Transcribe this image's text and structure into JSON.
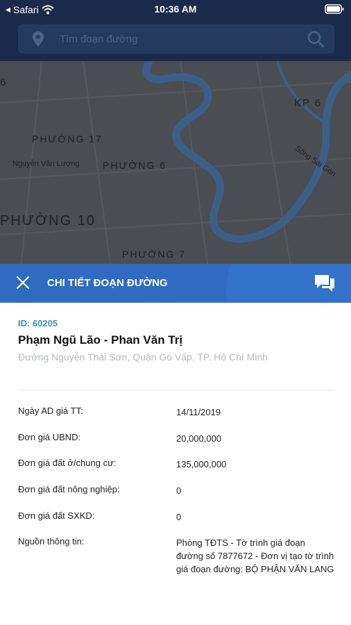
{
  "status_bar": {
    "carrier": "Safari",
    "time": "10:36 AM"
  },
  "search": {
    "placeholder": "Tìm đoạn đường",
    "value": ""
  },
  "map": {
    "labels": [
      "6",
      "KP 6",
      "PHƯỜNG 17",
      "Nguyễn Văn Lượng",
      "PHƯỜNG 6",
      "Sông Sài Gòn",
      "PHƯỜNG 10",
      "PHƯỜNG 7"
    ]
  },
  "sheet": {
    "title": "CHI TIẾT ĐOẠN ĐƯỜNG",
    "id_label": "ID: 60205",
    "road_name": "Phạm Ngũ Lão - Phan Văn Trị",
    "address": "Đường Nguyễn Thái Sơn, Quận Gò Vấp, TP. Hồ Chí Minh",
    "rows": [
      {
        "key": "Ngày AD giá TT:",
        "value": "14/11/2019"
      },
      {
        "key": "Đơn giá UBND:",
        "value": "20,000,000"
      },
      {
        "key": "Đơn giá đất ở/chung cư:",
        "value": "135,000,000"
      },
      {
        "key": "Đơn giá đất nông nghiệp:",
        "value": "0"
      },
      {
        "key": "Đơn giá đất SXKD:",
        "value": "0"
      },
      {
        "key": "Nguồn thông tin:",
        "value": "Phòng TĐTS - Tờ trình giá đoạn đường số 7877672 - Đơn vị tạo tờ trình giá đoạn đường: BỘ PHẬN VĂN LANG"
      }
    ]
  },
  "colors": {
    "header_navy": "#1b2a4a",
    "sheet_blue": "#2f6bc0",
    "id_blue": "#3a8fd8",
    "river": "#3c5f8a"
  }
}
